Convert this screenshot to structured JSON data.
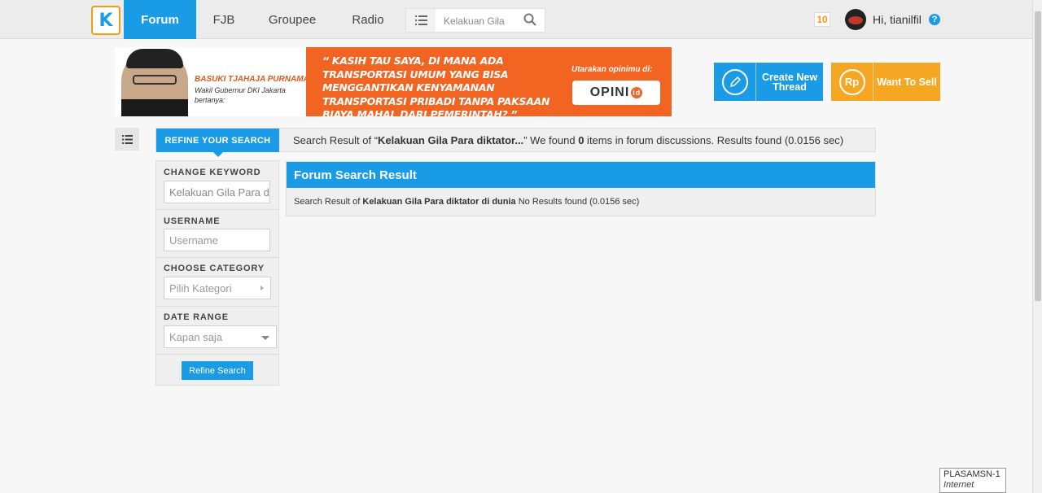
{
  "nav": {
    "items": [
      {
        "label": "Forum",
        "active": true
      },
      {
        "label": "FJB",
        "active": false
      },
      {
        "label": "Groupee",
        "active": false
      },
      {
        "label": "Radio",
        "active": false
      }
    ],
    "search_value": "Kelakuan Gila",
    "notifications": "10",
    "greeting": "Hi, tianilfil",
    "help": "?"
  },
  "banner": {
    "name": "BASUKI TJAHAJA PURNAMA",
    "role": "Wakil Gubernur DKI Jakarta bertanya:",
    "quote": "“ KASIH TAU SAYA, DI MANA ADA TRANSPORTASI UMUM YANG BISA MENGGANTIKAN KENYAMANAN TRANSPORTASI PRIBADI TANPA PAKSAAN BIAYA MAHAL DARI PEMERINTAH? ”",
    "cta": "Utarakan opinimu di:",
    "brand": "OPINI",
    "brand_suffix": "id"
  },
  "actions": {
    "create_label": "Create New Thread",
    "sell_label": "Want To Sell",
    "sell_icon_text": "Rp"
  },
  "refine": {
    "tab_label": "REFINE YOUR SEARCH",
    "result_prefix": "Search Result of “",
    "result_keyword": "Kelakuan Gila Para diktator...",
    "result_mid": "” We found ",
    "result_count": "0",
    "result_suffix": " items in forum discussions. Results found (0.0156 sec)",
    "keyword_label": "CHANGE KEYWORD",
    "keyword_value": "Kelakuan Gila Para d",
    "username_label": "USERNAME",
    "username_placeholder": "Username",
    "category_label": "CHOOSE CATEGORY",
    "category_value": "Pilih Kategori",
    "date_label": "DATE RANGE",
    "date_value": "Kapan saja",
    "button_label": "Refine Search"
  },
  "forum_result": {
    "title": "Forum Search Result",
    "prefix": "Search Result of ",
    "keyword": "Kelakuan Gila Para diktator di dunia",
    "suffix": " No Results found (0.0156 sec)"
  },
  "network_tip": {
    "name": "PLASAMSN-1",
    "status": "Internet access"
  },
  "colors": {
    "accent": "#1a9be6",
    "orange": "#f26422",
    "sell": "#f5a623"
  }
}
